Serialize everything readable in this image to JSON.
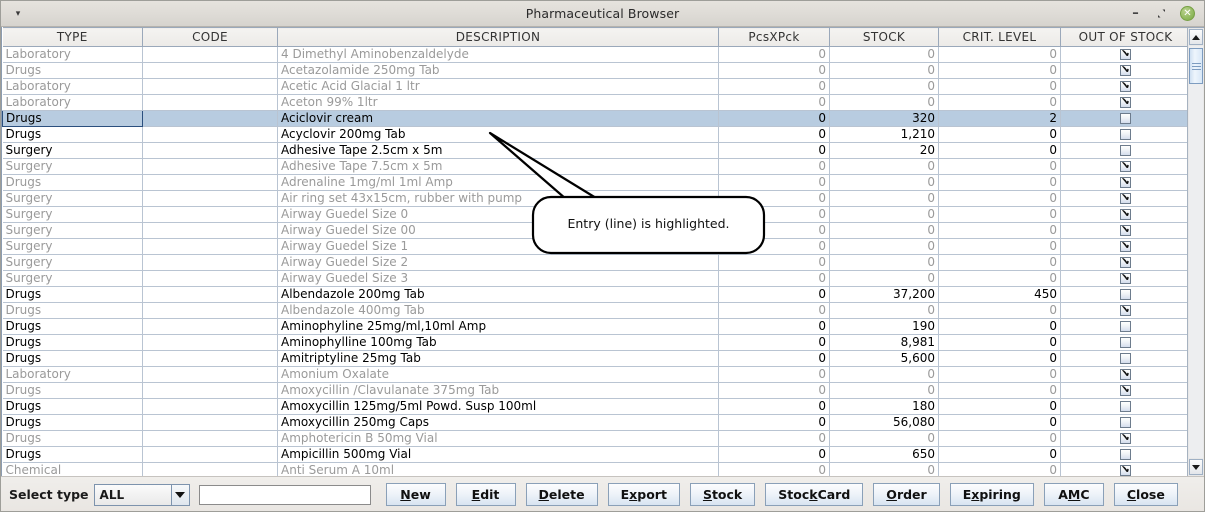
{
  "window": {
    "title": "Pharmaceutical Browser",
    "menu_icon": "chevron-down-icon",
    "minimize_label": "–",
    "maximize_label": "restore-icon",
    "close_label": "✕"
  },
  "table": {
    "columns": [
      "TYPE",
      "CODE",
      "DESCRIPTION",
      "PcsXPck",
      "STOCK",
      "CRIT. LEVEL",
      "OUT OF STOCK"
    ],
    "rows": [
      {
        "type": "Laboratory",
        "code": "",
        "description": "4 Dimethyl Aminobenzaldelyde",
        "pcsxpck": "0",
        "stock": "0",
        "crit": "0",
        "out": true,
        "dim": true,
        "selected": false
      },
      {
        "type": "Drugs",
        "code": "",
        "description": "Acetazolamide 250mg Tab",
        "pcsxpck": "0",
        "stock": "0",
        "crit": "0",
        "out": true,
        "dim": true,
        "selected": false
      },
      {
        "type": "Laboratory",
        "code": "",
        "description": "Acetic Acid Glacial 1 ltr",
        "pcsxpck": "0",
        "stock": "0",
        "crit": "0",
        "out": true,
        "dim": true,
        "selected": false
      },
      {
        "type": "Laboratory",
        "code": "",
        "description": "Aceton 99% 1ltr",
        "pcsxpck": "0",
        "stock": "0",
        "crit": "0",
        "out": true,
        "dim": true,
        "selected": false
      },
      {
        "type": "Drugs",
        "code": "",
        "description": "Aciclovir cream",
        "pcsxpck": "0",
        "stock": "320",
        "crit": "2",
        "out": false,
        "dim": false,
        "selected": true
      },
      {
        "type": "Drugs",
        "code": "",
        "description": "Acyclovir 200mg Tab",
        "pcsxpck": "0",
        "stock": "1,210",
        "crit": "0",
        "out": false,
        "dim": false,
        "selected": false
      },
      {
        "type": "Surgery",
        "code": "",
        "description": "Adhesive Tape 2.5cm x 5m",
        "pcsxpck": "0",
        "stock": "20",
        "crit": "0",
        "out": false,
        "dim": false,
        "selected": false
      },
      {
        "type": "Surgery",
        "code": "",
        "description": "Adhesive Tape 7.5cm x 5m",
        "pcsxpck": "0",
        "stock": "0",
        "crit": "0",
        "out": true,
        "dim": true,
        "selected": false
      },
      {
        "type": "Drugs",
        "code": "",
        "description": "Adrenaline 1mg/ml 1ml Amp",
        "pcsxpck": "0",
        "stock": "0",
        "crit": "0",
        "out": true,
        "dim": true,
        "selected": false
      },
      {
        "type": "Surgery",
        "code": "",
        "description": "Air ring set 43x15cm, rubber with pump",
        "pcsxpck": "0",
        "stock": "0",
        "crit": "0",
        "out": true,
        "dim": true,
        "selected": false
      },
      {
        "type": "Surgery",
        "code": "",
        "description": "Airway Guedel Size 0",
        "pcsxpck": "0",
        "stock": "0",
        "crit": "0",
        "out": true,
        "dim": true,
        "selected": false
      },
      {
        "type": "Surgery",
        "code": "",
        "description": "Airway Guedel Size 00",
        "pcsxpck": "0",
        "stock": "0",
        "crit": "0",
        "out": true,
        "dim": true,
        "selected": false
      },
      {
        "type": "Surgery",
        "code": "",
        "description": "Airway Guedel Size 1",
        "pcsxpck": "0",
        "stock": "0",
        "crit": "0",
        "out": true,
        "dim": true,
        "selected": false
      },
      {
        "type": "Surgery",
        "code": "",
        "description": "Airway Guedel Size 2",
        "pcsxpck": "0",
        "stock": "0",
        "crit": "0",
        "out": true,
        "dim": true,
        "selected": false
      },
      {
        "type": "Surgery",
        "code": "",
        "description": "Airway Guedel Size 3",
        "pcsxpck": "0",
        "stock": "0",
        "crit": "0",
        "out": true,
        "dim": true,
        "selected": false
      },
      {
        "type": "Drugs",
        "code": "",
        "description": "Albendazole 200mg Tab",
        "pcsxpck": "0",
        "stock": "37,200",
        "crit": "450",
        "out": false,
        "dim": false,
        "selected": false
      },
      {
        "type": "Drugs",
        "code": "",
        "description": "Albendazole 400mg Tab",
        "pcsxpck": "0",
        "stock": "0",
        "crit": "0",
        "out": true,
        "dim": true,
        "selected": false
      },
      {
        "type": "Drugs",
        "code": "",
        "description": "Aminophyline 25mg/ml,10ml Amp",
        "pcsxpck": "0",
        "stock": "190",
        "crit": "0",
        "out": false,
        "dim": false,
        "selected": false
      },
      {
        "type": "Drugs",
        "code": "",
        "description": "Aminophylline 100mg Tab",
        "pcsxpck": "0",
        "stock": "8,981",
        "crit": "0",
        "out": false,
        "dim": false,
        "selected": false
      },
      {
        "type": "Drugs",
        "code": "",
        "description": "Amitriptyline 25mg Tab",
        "pcsxpck": "0",
        "stock": "5,600",
        "crit": "0",
        "out": false,
        "dim": false,
        "selected": false
      },
      {
        "type": "Laboratory",
        "code": "",
        "description": "Amonium Oxalate",
        "pcsxpck": "0",
        "stock": "0",
        "crit": "0",
        "out": true,
        "dim": true,
        "selected": false
      },
      {
        "type": "Drugs",
        "code": "",
        "description": "Amoxycillin /Clavulanate 375mg Tab",
        "pcsxpck": "0",
        "stock": "0",
        "crit": "0",
        "out": true,
        "dim": true,
        "selected": false
      },
      {
        "type": "Drugs",
        "code": "",
        "description": "Amoxycillin 125mg/5ml Powd. Susp 100ml",
        "pcsxpck": "0",
        "stock": "180",
        "crit": "0",
        "out": false,
        "dim": false,
        "selected": false
      },
      {
        "type": "Drugs",
        "code": "",
        "description": "Amoxycillin 250mg Caps",
        "pcsxpck": "0",
        "stock": "56,080",
        "crit": "0",
        "out": false,
        "dim": false,
        "selected": false
      },
      {
        "type": "Drugs",
        "code": "",
        "description": "Amphotericin B 50mg Vial",
        "pcsxpck": "0",
        "stock": "0",
        "crit": "0",
        "out": true,
        "dim": true,
        "selected": false
      },
      {
        "type": "Drugs",
        "code": "",
        "description": "Ampicillin 500mg Vial",
        "pcsxpck": "0",
        "stock": "650",
        "crit": "0",
        "out": false,
        "dim": false,
        "selected": false
      },
      {
        "type": "Chemical",
        "code": "",
        "description": "Anti Serum A 10ml",
        "pcsxpck": "0",
        "stock": "0",
        "crit": "0",
        "out": true,
        "dim": true,
        "selected": false
      }
    ]
  },
  "callout": {
    "text": "Entry (line) is highlighted."
  },
  "bottom": {
    "select_type_label": "Select type",
    "combo_value": "ALL",
    "combo_arrow_icon": "chevron-down-icon",
    "search_value": "",
    "search_placeholder": "",
    "buttons": [
      {
        "pre": "",
        "key": "N",
        "post": "ew",
        "name": "new-button"
      },
      {
        "pre": "",
        "key": "E",
        "post": "dit",
        "name": "edit-button"
      },
      {
        "pre": "",
        "key": "D",
        "post": "elete",
        "name": "delete-button"
      },
      {
        "pre": "E",
        "key": "x",
        "post": "port",
        "name": "export-button"
      },
      {
        "pre": "",
        "key": "S",
        "post": "tock",
        "name": "stock-button"
      },
      {
        "pre": "Stoc",
        "key": "k",
        "post": "Card",
        "name": "stockcard-button"
      },
      {
        "pre": "",
        "key": "O",
        "post": "rder",
        "name": "order-button"
      },
      {
        "pre": "E",
        "key": "x",
        "post": "piring",
        "name": "expiring-button"
      },
      {
        "pre": "A",
        "key": "M",
        "post": "C",
        "name": "amc-button"
      },
      {
        "pre": "",
        "key": "C",
        "post": "lose",
        "name": "close-button"
      }
    ]
  },
  "scrollbar": {
    "up_icon": "arrow-up-icon",
    "down_icon": "arrow-down-icon"
  }
}
